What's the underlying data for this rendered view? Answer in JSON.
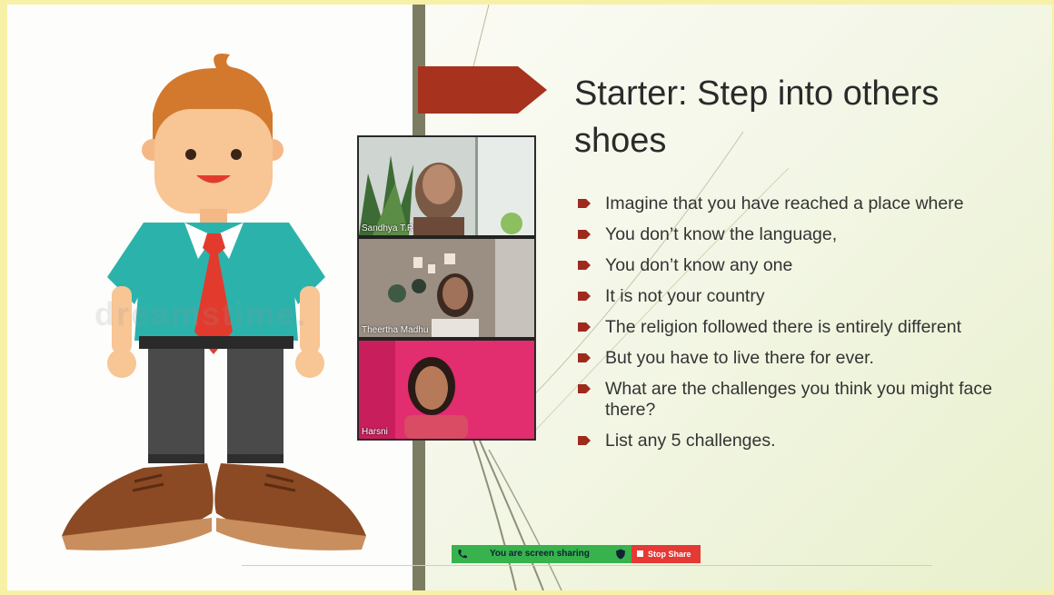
{
  "slide": {
    "title": "Starter: Step into others shoes",
    "bullets": [
      "Imagine that you have reached a place where",
      "You don’t know the language,",
      "You don’t know any one",
      "It is not your country",
      "The religion followed there is entirely different",
      "But you have to live there for ever.",
      "What are the challenges you think you might face there?",
      "List any 5 challenges."
    ],
    "watermark": "dreamstime."
  },
  "participants": [
    {
      "name": "Sandhya T.R"
    },
    {
      "name": "Theertha Madhu"
    },
    {
      "name": "Harsni"
    }
  ],
  "share_bar": {
    "status": "You are screen sharing",
    "stop_label": "Stop Share"
  },
  "colors": {
    "page_border": "#f7f1a8",
    "divider": "#7c7c63",
    "arrow_tag": "#a7321e",
    "bullet": "#9e2a1d",
    "share_green": "#37b24d",
    "stop_red": "#e53935"
  }
}
